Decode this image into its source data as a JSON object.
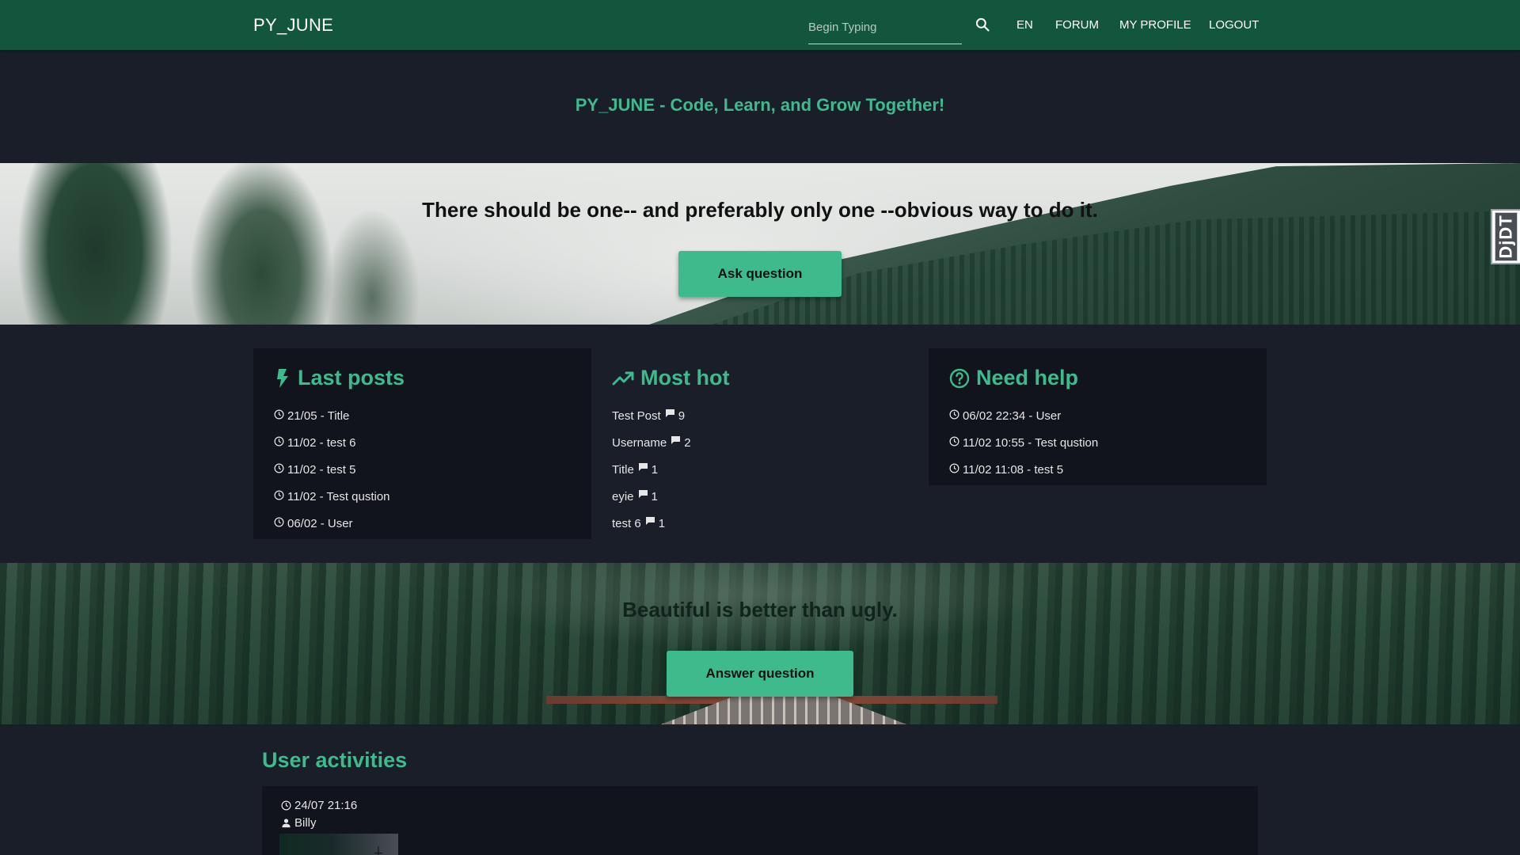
{
  "navbar": {
    "brand": "PY_JUNE",
    "search_placeholder": "Begin Typing",
    "search_icon": "search-icon",
    "links": {
      "lang": "EN",
      "forum": "FORUM",
      "profile": "MY PROFILE",
      "logout": "LOGOUT"
    },
    "bg_color": "#12573d"
  },
  "hero": {
    "tagline": "PY_JUNE - Code, Learn, and Grow Together!"
  },
  "banner_top": {
    "quote": "There should be one-- and preferably only one --obvious way to do it.",
    "button_label": "Ask question"
  },
  "banner_bottom": {
    "quote": "Beautiful is better than ugly.",
    "button_label": "Answer question"
  },
  "cards": {
    "last_posts": {
      "title": "Last posts",
      "icon": "bolt-icon",
      "items": [
        "21/05 - Title",
        "11/02 - test 6",
        "11/02 - test 5",
        "11/02 - Test qustion",
        "06/02 - User"
      ]
    },
    "most_hot": {
      "title": "Most hot",
      "icon": "trending-up-icon",
      "items": [
        {
          "name": "Test Post",
          "count": "9"
        },
        {
          "name": "Username",
          "count": "2"
        },
        {
          "name": "Title",
          "count": "1"
        },
        {
          "name": "eyie",
          "count": "1"
        },
        {
          "name": "test 6",
          "count": "1"
        }
      ]
    },
    "need_help": {
      "title": "Need help",
      "icon": "help-circle-icon",
      "items": [
        "06/02 22:34 - User",
        "11/02 10:55 - Test qustion",
        "11/02 11:08 - test 5"
      ]
    }
  },
  "user_activities": {
    "title": "User activities",
    "entries": [
      {
        "time": "24/07 21:16",
        "user": "Billy"
      }
    ]
  },
  "debug_toolbar": {
    "label": "DjDT"
  },
  "colors": {
    "accent": "#3dbb8c",
    "page_bg": "#191e29",
    "card_bg": "#11141d"
  }
}
